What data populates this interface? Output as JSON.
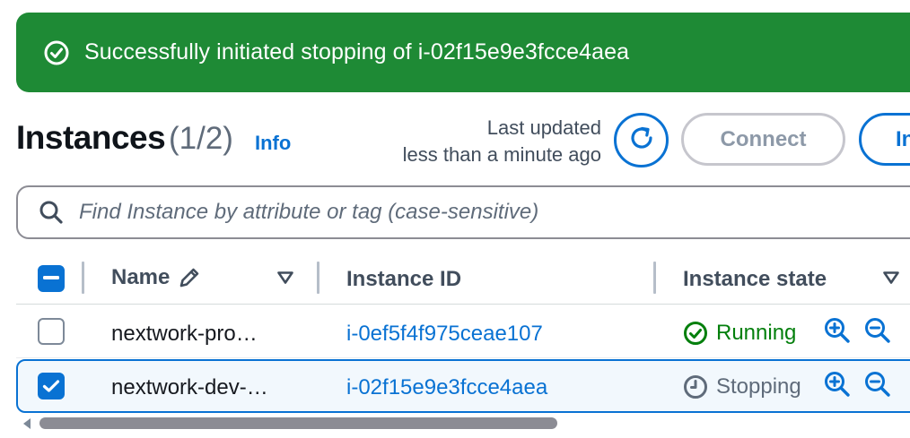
{
  "flash": {
    "icon": "success-check-icon",
    "message": "Successfully initiated stopping of i-02f15e9e3fcce4aea",
    "color": "#1e8a35"
  },
  "header": {
    "title": "Instances",
    "count": "(1/2)",
    "info_label": "Info",
    "last_updated_line1": "Last updated",
    "last_updated_line2": "less than a minute ago",
    "refresh_icon": "refresh-icon",
    "connect_label": "Connect",
    "next_button_label": "In"
  },
  "search": {
    "placeholder": "Find Instance by attribute or tag (case-sensitive)",
    "value": ""
  },
  "table": {
    "columns": [
      "Name",
      "Instance ID",
      "Instance state"
    ],
    "rows": [
      {
        "selected": false,
        "name": "nextwork-pro…",
        "instance_id": "i-0ef5f4f975ceae107",
        "state": "Running",
        "state_icon": "running-check-icon",
        "state_color": "#037f0c"
      },
      {
        "selected": true,
        "name": "nextwork-dev-…",
        "instance_id": "i-02f15e9e3fcce4aea",
        "state": "Stopping",
        "state_icon": "stopping-clock-icon",
        "state_color": "#5f6b7a"
      }
    ]
  },
  "colors": {
    "accent": "#0972d3",
    "success": "#037f0c"
  }
}
